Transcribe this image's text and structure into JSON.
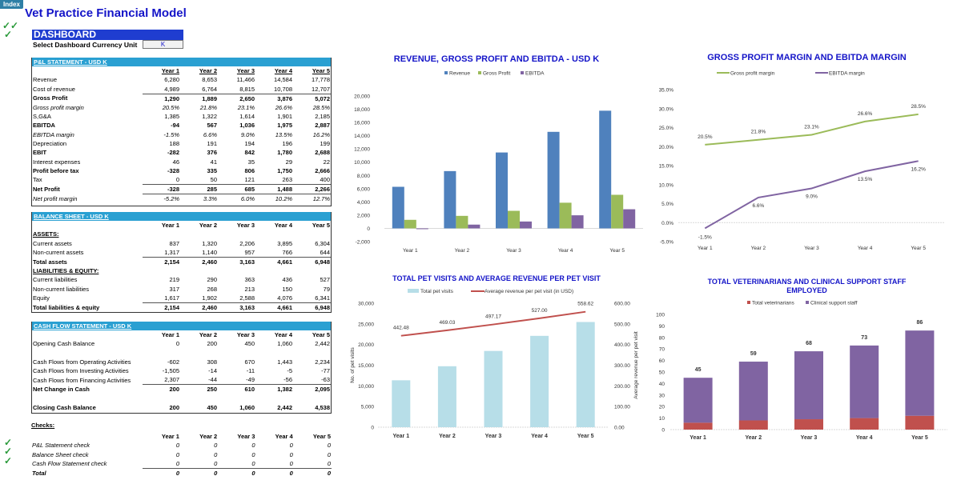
{
  "app": {
    "index_label": "Index",
    "title": "Vet Practice Financial Model",
    "dashboard_label": "DASHBOARD",
    "currency_label": "Select Dashboard Currency Unit",
    "currency_value": "K"
  },
  "years": [
    "Year 1",
    "Year 2",
    "Year 3",
    "Year 4",
    "Year 5"
  ],
  "pnl": {
    "title": "P&L STATEMENT - USD K",
    "rows": [
      {
        "label": "Revenue",
        "values": [
          "6,280",
          "8,653",
          "11,466",
          "14,584",
          "17,778"
        ],
        "style": ""
      },
      {
        "label": "Cost of revenue",
        "values": [
          "4,989",
          "6,764",
          "8,815",
          "10,708",
          "12,707"
        ],
        "style": ""
      },
      {
        "label": "Gross Profit",
        "values": [
          "1,290",
          "1,889",
          "2,650",
          "3,876",
          "5,072"
        ],
        "style": "bold topline"
      },
      {
        "label": "Gross profit margin",
        "values": [
          "20.5%",
          "21.8%",
          "23.1%",
          "26.6%",
          "28.5%"
        ],
        "style": "ital"
      },
      {
        "label": "S,G&A",
        "values": [
          "1,385",
          "1,322",
          "1,614",
          "1,901",
          "2,185"
        ],
        "style": ""
      },
      {
        "label": "EBITDA",
        "values": [
          "-94",
          "567",
          "1,036",
          "1,975",
          "2,887"
        ],
        "style": "bold"
      },
      {
        "label": "EBITDA margin",
        "values": [
          "-1.5%",
          "6.6%",
          "9.0%",
          "13.5%",
          "16.2%"
        ],
        "style": "ital"
      },
      {
        "label": "Depreciation",
        "values": [
          "188",
          "191",
          "194",
          "196",
          "199"
        ],
        "style": ""
      },
      {
        "label": "EBIT",
        "values": [
          "-282",
          "376",
          "842",
          "1,780",
          "2,688"
        ],
        "style": "bold"
      },
      {
        "label": "Interest expenses",
        "values": [
          "46",
          "41",
          "35",
          "29",
          "22"
        ],
        "style": ""
      },
      {
        "label": "Profit before tax",
        "values": [
          "-328",
          "335",
          "806",
          "1,750",
          "2,666"
        ],
        "style": "bold"
      },
      {
        "label": "Tax",
        "values": [
          "0",
          "50",
          "121",
          "263",
          "400"
        ],
        "style": ""
      },
      {
        "label": "Net Profit",
        "values": [
          "-328",
          "285",
          "685",
          "1,488",
          "2,266"
        ],
        "style": "bold topline"
      },
      {
        "label": "Net profit margin",
        "values": [
          "-5.2%",
          "3.3%",
          "6.0%",
          "10.2%",
          "12.7%"
        ],
        "style": "ital topline"
      }
    ]
  },
  "balance_sheet": {
    "title": "BALANCE SHEET - USD K",
    "rows": [
      {
        "label": "ASSETS:",
        "values": [
          "",
          "",
          "",
          "",
          ""
        ],
        "style": "sec"
      },
      {
        "label": "Current assets",
        "values": [
          "837",
          "1,320",
          "2,206",
          "3,895",
          "6,304"
        ],
        "style": ""
      },
      {
        "label": "Non-current assets",
        "values": [
          "1,317",
          "1,140",
          "957",
          "766",
          "644"
        ],
        "style": ""
      },
      {
        "label": "Total assets",
        "values": [
          "2,154",
          "2,460",
          "3,163",
          "4,661",
          "6,948"
        ],
        "style": "bold topline"
      },
      {
        "label": "LIABILITIES & EQUITY:",
        "values": [
          "",
          "",
          "",
          "",
          ""
        ],
        "style": "sec"
      },
      {
        "label": "Current liabilities",
        "values": [
          "219",
          "290",
          "363",
          "436",
          "527"
        ],
        "style": ""
      },
      {
        "label": "Non-current liabilities",
        "values": [
          "317",
          "268",
          "213",
          "150",
          "79"
        ],
        "style": ""
      },
      {
        "label": "Equity",
        "values": [
          "1,617",
          "1,902",
          "2,588",
          "4,076",
          "6,341"
        ],
        "style": ""
      },
      {
        "label": "Total liabilities & equity",
        "values": [
          "2,154",
          "2,460",
          "3,163",
          "4,661",
          "6,948"
        ],
        "style": "bold topline"
      }
    ]
  },
  "cash_flow": {
    "title": "CASH FLOW STATEMENT -  USD K",
    "rows": [
      {
        "label": "Opening Cash Balance",
        "values": [
          "0",
          "200",
          "450",
          "1,060",
          "2,442"
        ],
        "style": ""
      },
      {
        "label": "",
        "values": [
          "",
          "",
          "",
          "",
          ""
        ],
        "style": "spacer"
      },
      {
        "label": "Cash Flows from Operating Activities",
        "values": [
          "-602",
          "308",
          "670",
          "1,443",
          "2,234"
        ],
        "style": ""
      },
      {
        "label": "Cash Flows from Investing Activities",
        "values": [
          "-1,505",
          "-14",
          "-11",
          "-5",
          "-77"
        ],
        "style": ""
      },
      {
        "label": "Cash Flows from Financing Activities",
        "values": [
          "2,307",
          "-44",
          "-49",
          "-56",
          "-63"
        ],
        "style": ""
      },
      {
        "label": "Net Change in Cash",
        "values": [
          "200",
          "250",
          "610",
          "1,382",
          "2,095"
        ],
        "style": "bold topline"
      },
      {
        "label": "",
        "values": [
          "",
          "",
          "",
          "",
          ""
        ],
        "style": "spacer"
      },
      {
        "label": "Closing Cash Balance",
        "values": [
          "200",
          "450",
          "1,060",
          "2,442",
          "4,538"
        ],
        "style": "bold"
      }
    ]
  },
  "checks": {
    "title": "Checks:",
    "rows": [
      {
        "label": "P&L Statement check",
        "values": [
          "0",
          "0",
          "0",
          "0",
          "0"
        ],
        "style": "ital",
        "ok": true
      },
      {
        "label": "Balance Sheet check",
        "values": [
          "0",
          "0",
          "0",
          "0",
          "0"
        ],
        "style": "ital",
        "ok": true
      },
      {
        "label": "Cash Flow Statement check",
        "values": [
          "0",
          "0",
          "0",
          "0",
          "0"
        ],
        "style": "ital",
        "ok": true
      },
      {
        "label": "Total",
        "values": [
          "0",
          "0",
          "0",
          "0",
          "0"
        ],
        "style": "bold ital topline",
        "ok": false
      }
    ]
  },
  "colors": {
    "title_blue": "#1414c8",
    "section_header": "#2aa0d2",
    "revenue": "#4f81bd",
    "gross_profit": "#9bbb59",
    "ebitda": "#8064a2",
    "pet_visits": "#b7dee8",
    "avg_revenue": "#c0504d",
    "veterinarians": "#c0504d",
    "support_staff": "#8064a2",
    "check": "#2a9a3a"
  },
  "chart_data": [
    {
      "id": "rev",
      "type": "bar",
      "title": "REVENUE, GROSS PROFIT AND EBITDA - USD K",
      "categories": [
        "Year 1",
        "Year 2",
        "Year 3",
        "Year 4",
        "Year 5"
      ],
      "series": [
        {
          "name": "Revenue",
          "values": [
            6280,
            8653,
            11466,
            14584,
            17778
          ]
        },
        {
          "name": "Gross Profit",
          "values": [
            1290,
            1889,
            2650,
            3876,
            5072
          ]
        },
        {
          "name": "EBITDA",
          "values": [
            -94,
            567,
            1036,
            1975,
            2887
          ]
        }
      ],
      "ylim": [
        -2000,
        20000
      ],
      "yticks": [
        "-2,000",
        "0",
        "2,000",
        "4,000",
        "6,000",
        "8,000",
        "10,000",
        "12,000",
        "14,000",
        "16,000",
        "18,000",
        "20,000"
      ],
      "legend": "top"
    },
    {
      "id": "margin",
      "type": "line",
      "title": "GROSS PROFIT MARGIN AND EBITDA MARGIN",
      "categories": [
        "Year 1",
        "Year 2",
        "Year 3",
        "Year 4",
        "Year 5"
      ],
      "series": [
        {
          "name": "Gross profit margin",
          "values": [
            20.5,
            21.8,
            23.1,
            26.6,
            28.5
          ],
          "labels": [
            "20.5%",
            "21.8%",
            "23.1%",
            "26.6%",
            "28.5%"
          ]
        },
        {
          "name": "EBITDA margin",
          "values": [
            -1.5,
            6.6,
            9.0,
            13.5,
            16.2
          ],
          "labels": [
            "-1.5%",
            "6.6%",
            "9.0%",
            "13.5%",
            "16.2%"
          ]
        }
      ],
      "ylim": [
        -5,
        35
      ],
      "yticks": [
        "-5.0%",
        "0.0%",
        "5.0%",
        "10.0%",
        "15.0%",
        "20.0%",
        "25.0%",
        "30.0%",
        "35.0%"
      ],
      "legend": "top"
    },
    {
      "id": "visits",
      "type": "bar",
      "title": "TOTAL PET VISITS AND AVERAGE REVENUE PER PET VISIT",
      "categories": [
        "Year 1",
        "Year 2",
        "Year 3",
        "Year 4",
        "Year 5"
      ],
      "series": [
        {
          "name": "Total pet visits",
          "type": "bar",
          "axis": "left",
          "values": [
            11350,
            14750,
            18450,
            22100,
            25450
          ]
        },
        {
          "name": "Average revenue per pet visit (in USD)",
          "type": "line",
          "axis": "right",
          "values": [
            442.48,
            469.03,
            497.17,
            527.0,
            558.62
          ],
          "labels": [
            "442.48",
            "469.03",
            "497.17",
            "527.00",
            "558.62"
          ]
        }
      ],
      "ylim": [
        0,
        30000
      ],
      "y2lim": [
        0,
        600
      ],
      "yticks": [
        "0",
        "5,000",
        "10,000",
        "15,000",
        "20,000",
        "25,000",
        "30,000"
      ],
      "y2ticks": [
        "0.00",
        "100.00",
        "200.00",
        "300.00",
        "400.00",
        "500.00",
        "600.00"
      ],
      "ylabel": "No. of  pet  visits",
      "y2label": "Average  revenue per pet visit",
      "legend": "top"
    },
    {
      "id": "staff",
      "type": "bar",
      "stacked": true,
      "title": "TOTAL VETERINARIANS AND CLINICAL SUPPORT STAFF EMPLOYED",
      "title_lines": [
        "TOTAL VETERINARIANS AND CLINICAL SUPPORT STAFF",
        "EMPLOYED"
      ],
      "categories": [
        "Year 1",
        "Year 2",
        "Year 3",
        "Year 4",
        "Year 5"
      ],
      "series": [
        {
          "name": "Total veterinarians",
          "values": [
            6,
            8,
            9,
            10,
            12
          ]
        },
        {
          "name": "Clinical support staff",
          "values": [
            39,
            51,
            59,
            63,
            74
          ]
        }
      ],
      "totals": [
        "45",
        "59",
        "68",
        "73",
        "86"
      ],
      "ylim": [
        0,
        100
      ],
      "yticks": [
        "0",
        "10",
        "20",
        "30",
        "40",
        "50",
        "60",
        "70",
        "80",
        "90",
        "100"
      ],
      "legend": "top"
    }
  ]
}
